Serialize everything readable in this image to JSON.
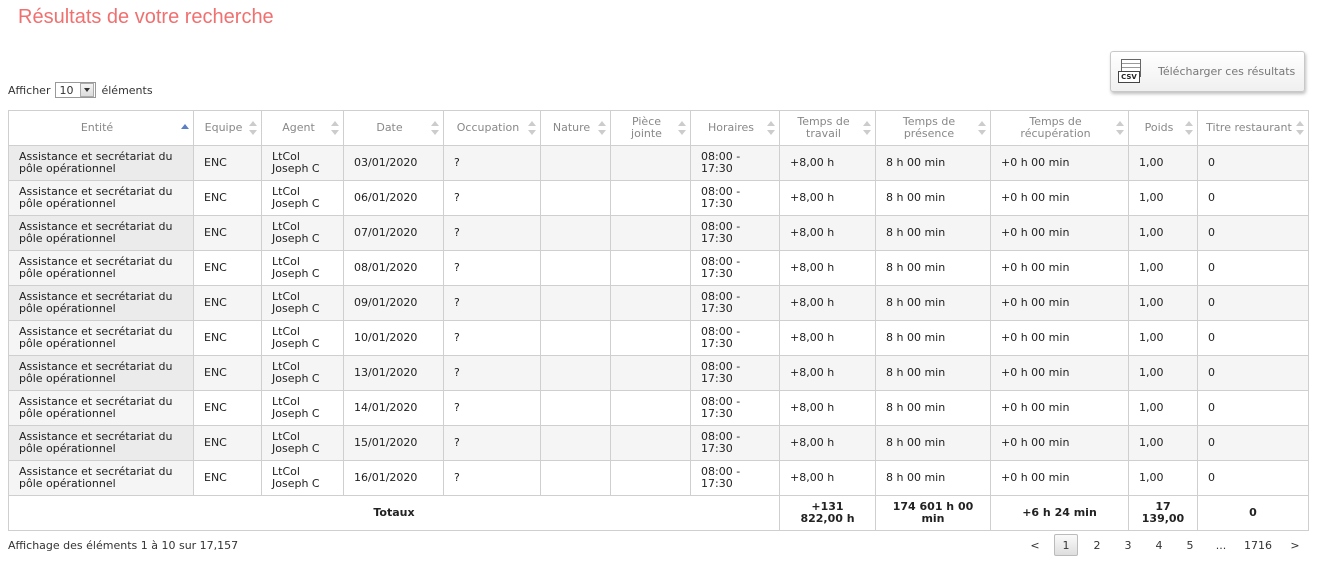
{
  "page": {
    "title": "Résultats de votre recherche"
  },
  "length_control": {
    "before": "Afficher",
    "value": "10",
    "after": "éléments"
  },
  "csv_button": {
    "label": "Télécharger ces résultats",
    "icon_text": "CSV"
  },
  "table": {
    "headers": [
      {
        "label": "Entité",
        "sort": "asc"
      },
      {
        "label": "Equipe",
        "sort": "none"
      },
      {
        "label": "Agent",
        "sort": "none"
      },
      {
        "label": "Date",
        "sort": "none"
      },
      {
        "label": "Occupation",
        "sort": "none"
      },
      {
        "label": "Nature",
        "sort": "none"
      },
      {
        "label": "Pièce jointe",
        "sort": "none"
      },
      {
        "label": "Horaires",
        "sort": "none"
      },
      {
        "label": "Temps de travail",
        "sort": "none"
      },
      {
        "label": "Temps de présence",
        "sort": "none"
      },
      {
        "label": "Temps de récupération",
        "sort": "none"
      },
      {
        "label": "Poids",
        "sort": "none"
      },
      {
        "label": "Titre restaurant",
        "sort": "none"
      }
    ],
    "rows": [
      [
        "Assistance et secrétariat du pôle opérationnel",
        "ENC",
        "LtCol Joseph C",
        "03/01/2020",
        "?",
        "",
        "",
        "08:00 - 17:30",
        "+8,00 h",
        "8 h 00 min",
        "+0 h 00 min",
        "1,00",
        "0"
      ],
      [
        "Assistance et secrétariat du pôle opérationnel",
        "ENC",
        "LtCol Joseph C",
        "06/01/2020",
        "?",
        "",
        "",
        "08:00 - 17:30",
        "+8,00 h",
        "8 h 00 min",
        "+0 h 00 min",
        "1,00",
        "0"
      ],
      [
        "Assistance et secrétariat du pôle opérationnel",
        "ENC",
        "LtCol Joseph C",
        "07/01/2020",
        "?",
        "",
        "",
        "08:00 - 17:30",
        "+8,00 h",
        "8 h 00 min",
        "+0 h 00 min",
        "1,00",
        "0"
      ],
      [
        "Assistance et secrétariat du pôle opérationnel",
        "ENC",
        "LtCol Joseph C",
        "08/01/2020",
        "?",
        "",
        "",
        "08:00 - 17:30",
        "+8,00 h",
        "8 h 00 min",
        "+0 h 00 min",
        "1,00",
        "0"
      ],
      [
        "Assistance et secrétariat du pôle opérationnel",
        "ENC",
        "LtCol Joseph C",
        "09/01/2020",
        "?",
        "",
        "",
        "08:00 - 17:30",
        "+8,00 h",
        "8 h 00 min",
        "+0 h 00 min",
        "1,00",
        "0"
      ],
      [
        "Assistance et secrétariat du pôle opérationnel",
        "ENC",
        "LtCol Joseph C",
        "10/01/2020",
        "?",
        "",
        "",
        "08:00 - 17:30",
        "+8,00 h",
        "8 h 00 min",
        "+0 h 00 min",
        "1,00",
        "0"
      ],
      [
        "Assistance et secrétariat du pôle opérationnel",
        "ENC",
        "LtCol Joseph C",
        "13/01/2020",
        "?",
        "",
        "",
        "08:00 - 17:30",
        "+8,00 h",
        "8 h 00 min",
        "+0 h 00 min",
        "1,00",
        "0"
      ],
      [
        "Assistance et secrétariat du pôle opérationnel",
        "ENC",
        "LtCol Joseph C",
        "14/01/2020",
        "?",
        "",
        "",
        "08:00 - 17:30",
        "+8,00 h",
        "8 h 00 min",
        "+0 h 00 min",
        "1,00",
        "0"
      ],
      [
        "Assistance et secrétariat du pôle opérationnel",
        "ENC",
        "LtCol Joseph C",
        "15/01/2020",
        "?",
        "",
        "",
        "08:00 - 17:30",
        "+8,00 h",
        "8 h 00 min",
        "+0 h 00 min",
        "1,00",
        "0"
      ],
      [
        "Assistance et secrétariat du pôle opérationnel",
        "ENC",
        "LtCol Joseph C",
        "16/01/2020",
        "?",
        "",
        "",
        "08:00 - 17:30",
        "+8,00 h",
        "8 h 00 min",
        "+0 h 00 min",
        "1,00",
        "0"
      ]
    ],
    "totals": {
      "label": "Totaux",
      "temps_travail": "+131 822,00 h",
      "temps_presence": "174 601 h 00 min",
      "temps_recuperation": "+6 h 24 min",
      "poids": "17 139,00",
      "titre_restaurant": "0"
    }
  },
  "footer": {
    "info": "Affichage des éléments 1 à 10 sur 17,157",
    "pagination": {
      "prev": "<",
      "pages": [
        "1",
        "2",
        "3",
        "4",
        "5"
      ],
      "current": "1",
      "ellipsis": "...",
      "last": "1716",
      "next": ">"
    }
  }
}
